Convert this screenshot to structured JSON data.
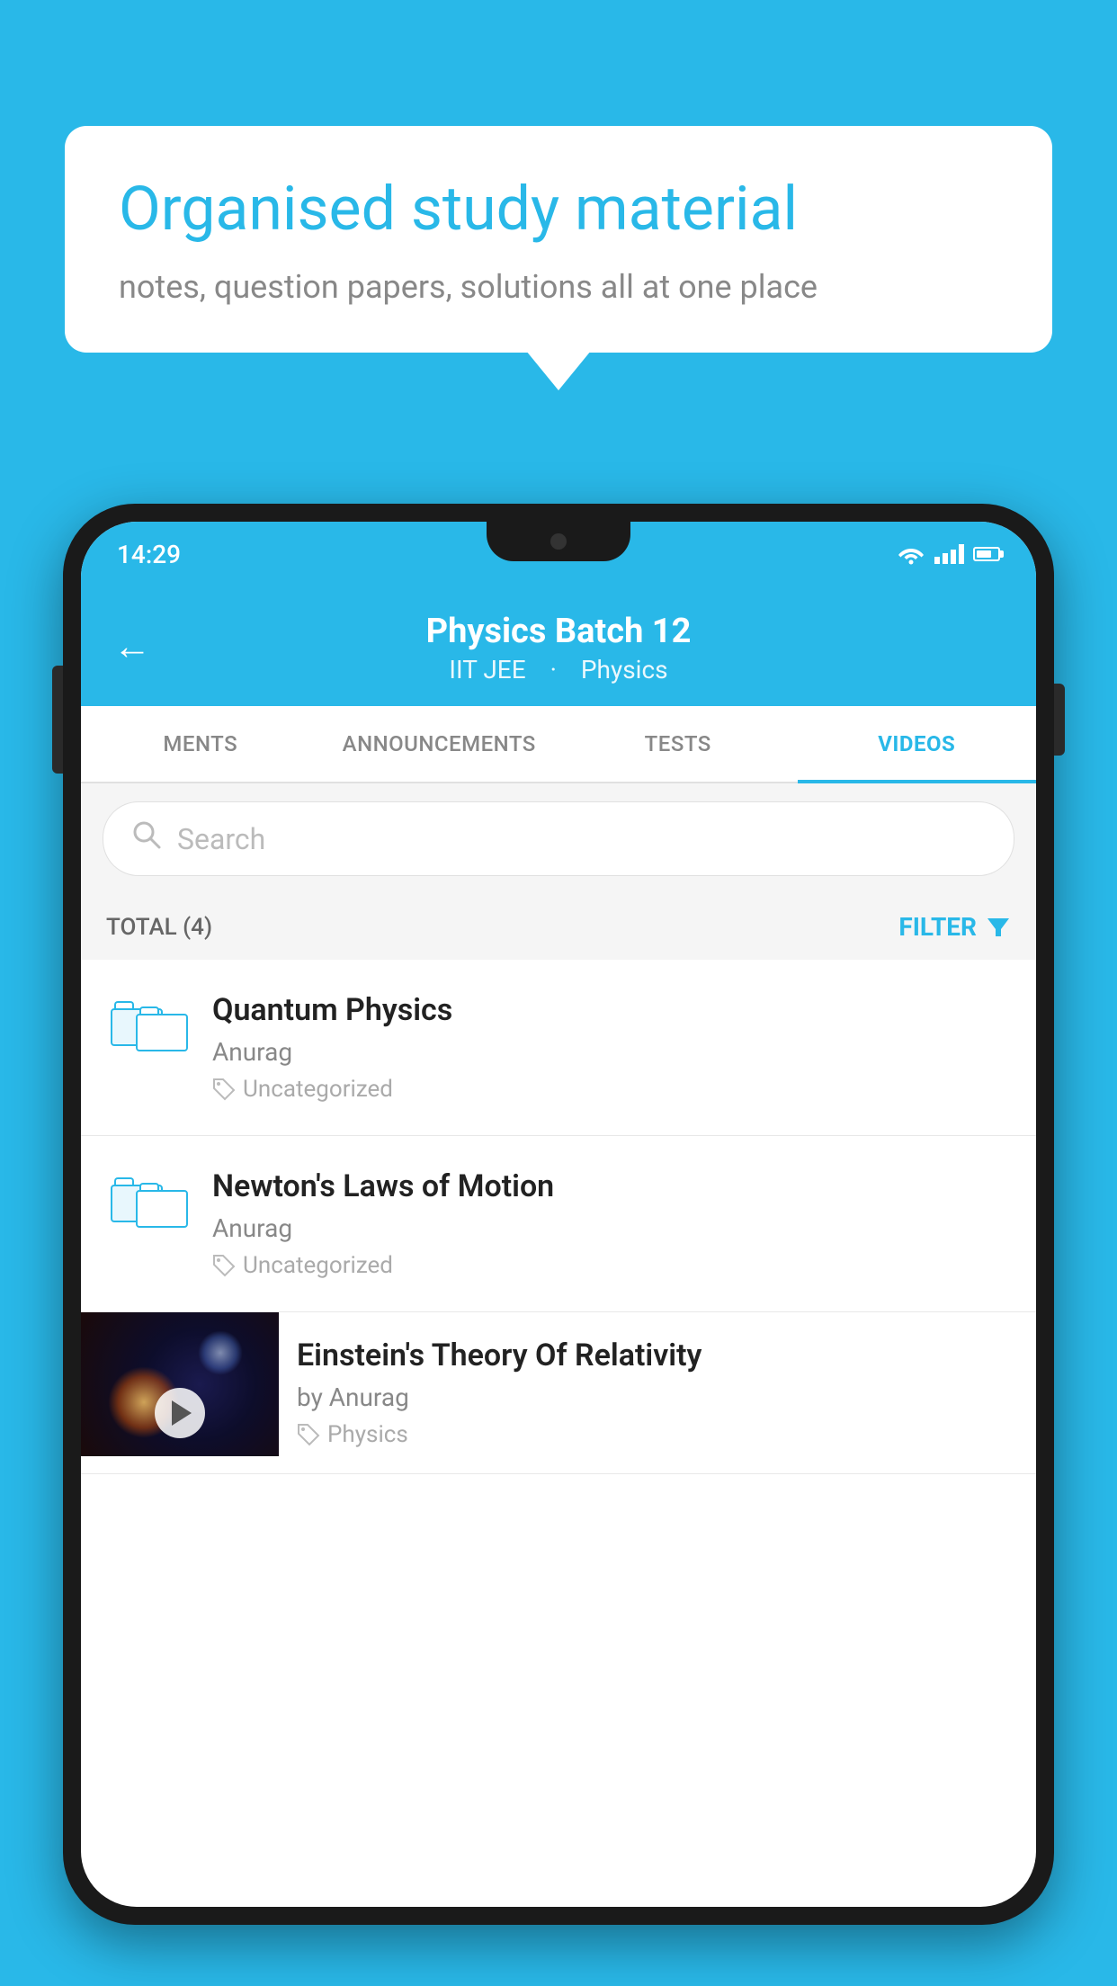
{
  "background": "#29b8e8",
  "bubble": {
    "title": "Organised study material",
    "subtitle": "notes, question papers, solutions all at one place"
  },
  "status_bar": {
    "time": "14:29",
    "signal": "wifi+bars"
  },
  "header": {
    "title": "Physics Batch 12",
    "subtitle_part1": "IIT JEE",
    "subtitle_part2": "Physics",
    "back_label": "←"
  },
  "tabs": [
    {
      "label": "MENTS",
      "active": false
    },
    {
      "label": "ANNOUNCEMENTS",
      "active": false
    },
    {
      "label": "TESTS",
      "active": false
    },
    {
      "label": "VIDEOS",
      "active": true
    }
  ],
  "search": {
    "placeholder": "Search"
  },
  "filter_bar": {
    "total_label": "TOTAL (4)",
    "filter_label": "FILTER"
  },
  "videos": [
    {
      "title": "Quantum Physics",
      "author": "Anurag",
      "tag": "Uncategorized",
      "has_thumb": false
    },
    {
      "title": "Newton's Laws of Motion",
      "author": "Anurag",
      "tag": "Uncategorized",
      "has_thumb": false
    },
    {
      "title": "Einstein's Theory Of Relativity",
      "author": "by Anurag",
      "tag": "Physics",
      "has_thumb": true
    }
  ]
}
